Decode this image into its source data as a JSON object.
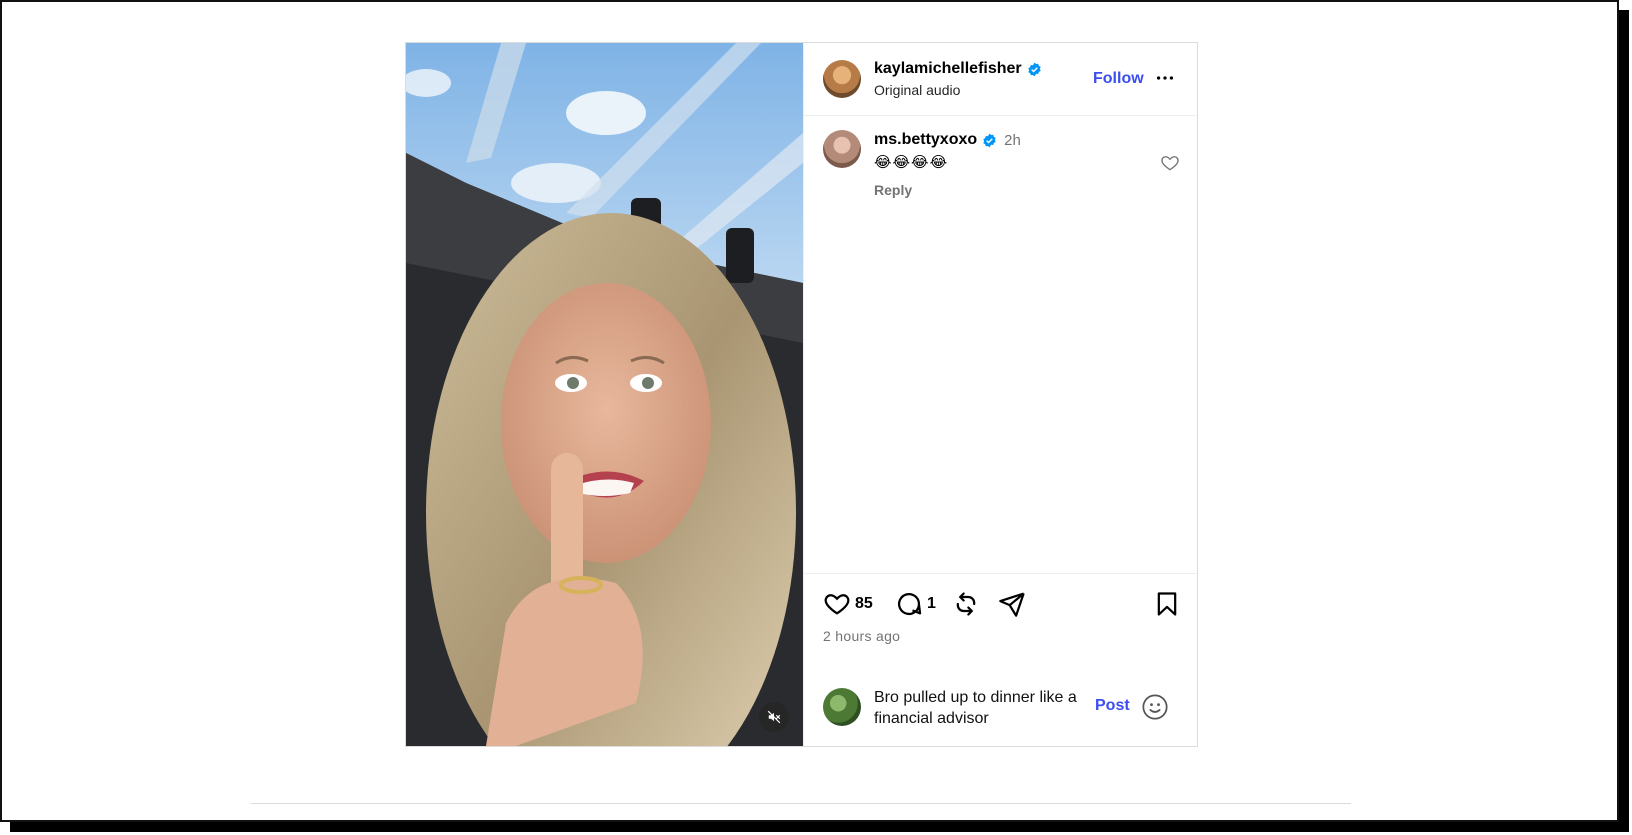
{
  "post": {
    "author": {
      "username": "kaylamichellefisher",
      "subtitle": "Original audio",
      "verified": true
    },
    "follow_label": "Follow",
    "comments": [
      {
        "username": "ms.bettyxoxo",
        "verified": true,
        "time": "2h",
        "text": "😂😂😂😂",
        "reply_label": "Reply"
      }
    ],
    "actions": {
      "like_count": "85",
      "comment_count": "1"
    },
    "timestamp": "2 hours ago",
    "composer": {
      "draft": "Bro pulled up to dinner like a financial advisor",
      "post_label": "Post"
    }
  },
  "colors": {
    "accent": "#3b4ef0",
    "verified_badge": "#0095f6",
    "muted_text": "#737373",
    "border": "#dbdbdb"
  },
  "icons": [
    "verified-icon",
    "more-icon",
    "heart-icon",
    "comment-icon",
    "repost-icon",
    "share-icon",
    "bookmark-icon",
    "emoji-icon",
    "mute-icon"
  ]
}
